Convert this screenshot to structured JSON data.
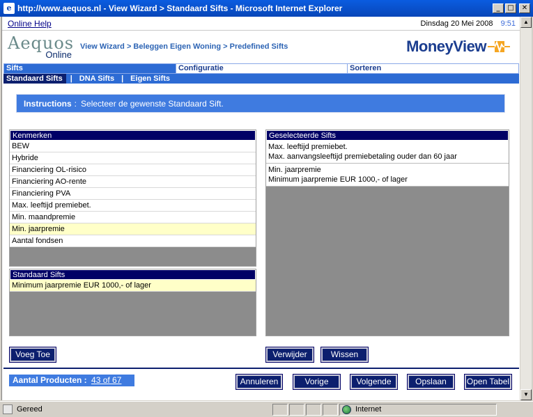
{
  "window": {
    "title": "http://www.aequos.nl - View Wizard > Standaard Sifts - Microsoft Internet Explorer",
    "minimize": "_",
    "maximize": "□",
    "close": "✕"
  },
  "topbar": {
    "help_link": "Online Help",
    "date": "Dinsdag 20 Mei 2008",
    "time": "9:51"
  },
  "header": {
    "logo_line1": "Aequos",
    "logo_line2": "Online",
    "breadcrumb": "View Wizard > Beleggen Eigen Woning > Predefined Sifts",
    "brand": "MoneyView",
    "brand_color": "#1b3d8f",
    "accent_color": "#f5a623"
  },
  "tabs": {
    "main": [
      "Sifts",
      "Configuratie",
      "Sorteren"
    ],
    "sub": [
      "Standaard Sifts",
      "DNA Sifts",
      "Eigen Sifts"
    ],
    "separator": "|"
  },
  "instructions": {
    "label": "Instructions",
    "colon": ":",
    "text": "Selecteer de gewenste Standaard Sift."
  },
  "kenmerken": {
    "header": "Kenmerken",
    "items": [
      "BEW",
      "Hybride",
      "Financiering OL-risico",
      "Financiering AO-rente",
      "Financiering PVA",
      "Max. leeftijd premiebet.",
      "Min. maandpremie",
      "Min. jaarpremie",
      "Aantal fondsen"
    ],
    "selected_index": 7
  },
  "standaard_sifts": {
    "header": "Standaard Sifts",
    "items": [
      "Minimum jaarpremie EUR 1000,- of lager"
    ]
  },
  "geselecteerde": {
    "header": "Geselecteerde Sifts",
    "items": [
      {
        "title": "Max. leeftijd premiebet.",
        "desc": "Max. aanvangsleeftijd premiebetaling ouder dan 60 jaar"
      },
      {
        "title": "Min. jaarpremie",
        "desc": "Minimum jaarpremie EUR 1000,- of lager"
      }
    ]
  },
  "buttons": {
    "voeg_toe": "Voeg Toe",
    "verwijder": "Verwijder",
    "wissen": "Wissen",
    "annuleren": "Annuleren",
    "vorige": "Vorige",
    "volgende": "Volgende",
    "opslaan": "Opslaan",
    "open_tabel": "Open Tabel"
  },
  "footer": {
    "count_label": "Aantal Producten :",
    "count_link": "43 of 67"
  },
  "statusbar": {
    "status": "Gereed",
    "zone": "Internet"
  }
}
